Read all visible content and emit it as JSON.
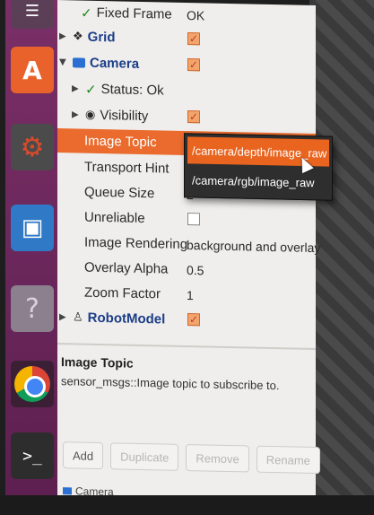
{
  "rviz": {
    "rows": [
      {
        "label": "Fixed Frame",
        "value": "OK"
      },
      {
        "label": "Grid"
      },
      {
        "label": "Camera"
      },
      {
        "label": "Status: Ok"
      },
      {
        "label": "Visibility"
      },
      {
        "label": "Image Topic",
        "value": ""
      },
      {
        "label": "Transport Hint"
      },
      {
        "label": "Queue Size",
        "value": "2"
      },
      {
        "label": "Unreliable"
      },
      {
        "label": "Image Rendering",
        "value": "background and overlay"
      },
      {
        "label": "Overlay Alpha",
        "value": "0.5"
      },
      {
        "label": "Zoom Factor",
        "value": "1"
      },
      {
        "label": "RobotModel"
      }
    ],
    "description": {
      "title": "Image Topic",
      "body": "sensor_msgs::Image topic to subscribe to."
    },
    "buttons": {
      "add": "Add",
      "duplicate": "Duplicate",
      "remove": "Remove",
      "rename": "Rename"
    },
    "bottom_tab": "Camera"
  },
  "dropdown": {
    "options": [
      "/camera/depth/image_raw",
      "/camera/rgb/image_raw"
    ],
    "highlighted_index": 0
  },
  "launcher": {
    "items": [
      "menu-icon",
      "software-center-icon",
      "settings-icon",
      "screenshot-icon",
      "help-icon",
      "chrome-icon",
      "terminal-icon"
    ]
  },
  "colors": {
    "selection": "#ea6b2d",
    "launcher": "#6b2a5d",
    "link_blue": "#1d3e88",
    "status_green": "#1f8a22"
  }
}
